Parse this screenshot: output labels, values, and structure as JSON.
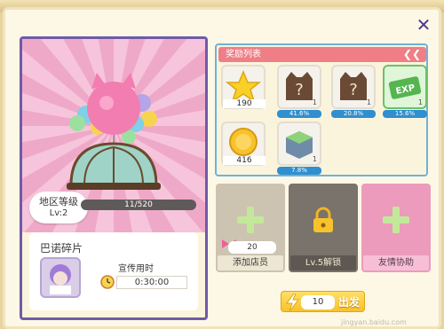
{
  "top_banner": {
    "left_text": "…",
    "right_text": "…"
  },
  "close": {
    "label": "✕"
  },
  "shop": {
    "level_label": "地区等级",
    "level_value": "Lv:2",
    "exp_text": "11/520",
    "exp_fraction": 0.021
  },
  "fragment": {
    "title": "巴诺碎片",
    "promo_label": "宣传用时",
    "promo_time": "0:30:00"
  },
  "rewards": {
    "header": "奖励列表",
    "items": [
      {
        "icon": "star-icon",
        "amount": "190",
        "count": "",
        "chance": ""
      },
      {
        "icon": "mystery-box-icon",
        "amount": "",
        "count": "1",
        "chance": "41.6%"
      },
      {
        "icon": "mystery-box-icon",
        "amount": "",
        "count": "1",
        "chance": "20.8%"
      },
      {
        "icon": "exp-ticket-icon",
        "amount": "",
        "count": "1",
        "chance": "15.6%"
      },
      {
        "icon": "gold-coin-icon",
        "amount": "416",
        "count": "",
        "chance": ""
      },
      {
        "icon": "grass-block-icon",
        "amount": "",
        "count": "1",
        "chance": "7.8%"
      }
    ]
  },
  "actions": {
    "add_staff": {
      "label": "添加店员",
      "staff_count": "20"
    },
    "locked": {
      "label": "Lv.5解锁"
    },
    "friend_help": {
      "label": "友情协助"
    }
  },
  "start": {
    "cost": "10",
    "label": "出发"
  },
  "watermark": "jingyan.baidu.com",
  "colors": {
    "accent": "#ef7e86",
    "panel_border": "#6f5aa8",
    "progress": "#2f8fcf"
  }
}
